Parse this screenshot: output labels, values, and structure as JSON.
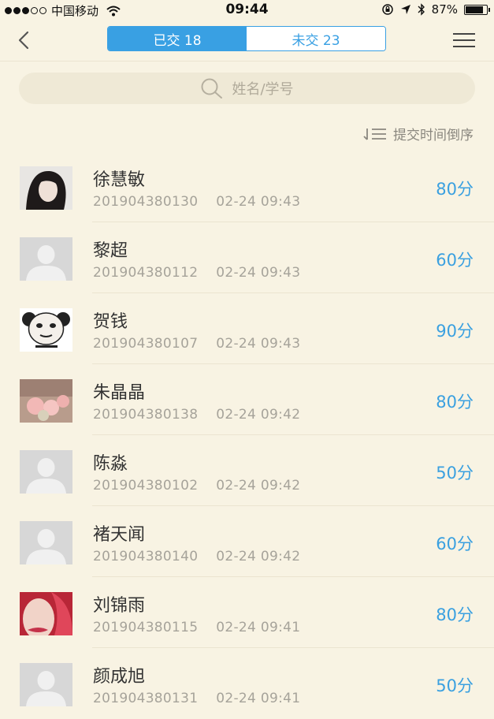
{
  "status_bar": {
    "carrier": "中国移动",
    "time": "09:44",
    "battery": "87%"
  },
  "nav": {
    "tabs": [
      {
        "label": "已交 18"
      },
      {
        "label": "未交 23"
      }
    ]
  },
  "search": {
    "placeholder": "姓名/学号"
  },
  "sort": {
    "label": "提交时间倒序"
  },
  "students": [
    {
      "name": "徐慧敏",
      "id": "201904380130",
      "time": "02-24 09:43",
      "score": "80分",
      "avatar": "photo-girl-dark"
    },
    {
      "name": "黎超",
      "id": "201904380112",
      "time": "02-24 09:43",
      "score": "60分",
      "avatar": "default"
    },
    {
      "name": "贺钱",
      "id": "201904380107",
      "time": "02-24 09:43",
      "score": "90分",
      "avatar": "meme-panda"
    },
    {
      "name": "朱晶晶",
      "id": "201904380138",
      "time": "02-24 09:42",
      "score": "80分",
      "avatar": "photo-flowers"
    },
    {
      "name": "陈淼",
      "id": "201904380102",
      "time": "02-24 09:42",
      "score": "50分",
      "avatar": "default"
    },
    {
      "name": "褚天闻",
      "id": "201904380140",
      "time": "02-24 09:42",
      "score": "60分",
      "avatar": "default"
    },
    {
      "name": "刘锦雨",
      "id": "201904380115",
      "time": "02-24 09:41",
      "score": "80分",
      "avatar": "photo-girl-red"
    },
    {
      "name": "颜成旭",
      "id": "201904380131",
      "time": "02-24 09:41",
      "score": "50分",
      "avatar": "default"
    }
  ],
  "colors": {
    "background": "#f8f3e3",
    "accent": "#39a0e3",
    "score": "#3aa0e0"
  }
}
